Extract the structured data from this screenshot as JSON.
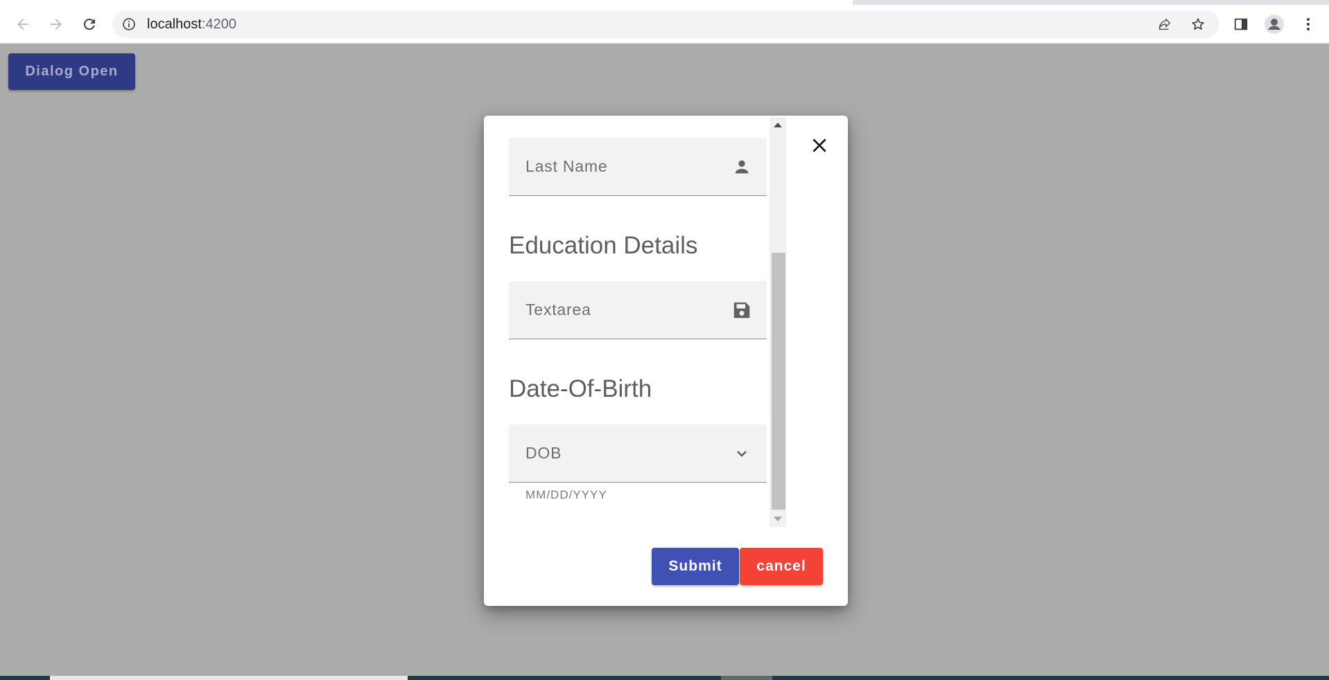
{
  "browser": {
    "url_host": "localhost",
    "url_port": ":4200",
    "icons": {
      "back": "arrow-left-icon",
      "forward": "arrow-right-icon",
      "reload": "reload-icon",
      "site_info": "info-icon",
      "share": "share-icon",
      "bookmark": "star-icon",
      "side_panel": "side-panel-icon",
      "profile": "profile-icon",
      "menu": "more-vert-icon"
    }
  },
  "page": {
    "open_dialog_label": "Dialog Open"
  },
  "dialog": {
    "fields": {
      "last_name": {
        "label": "Last Name",
        "icon": "person-icon"
      },
      "textarea": {
        "label": "Textarea",
        "icon": "save-icon"
      },
      "dob": {
        "label": "DOB",
        "icon": "chevron-down-icon",
        "hint": "MM/DD/YYYY"
      }
    },
    "sections": {
      "education": "Education Details",
      "dob": "Date-Of-Birth"
    },
    "buttons": {
      "submit": "Submit",
      "cancel": "cancel"
    },
    "close_icon": "close-icon"
  },
  "colors": {
    "primary": "#3f51b5",
    "warn": "#f44336",
    "backdrop": "#ababab"
  }
}
